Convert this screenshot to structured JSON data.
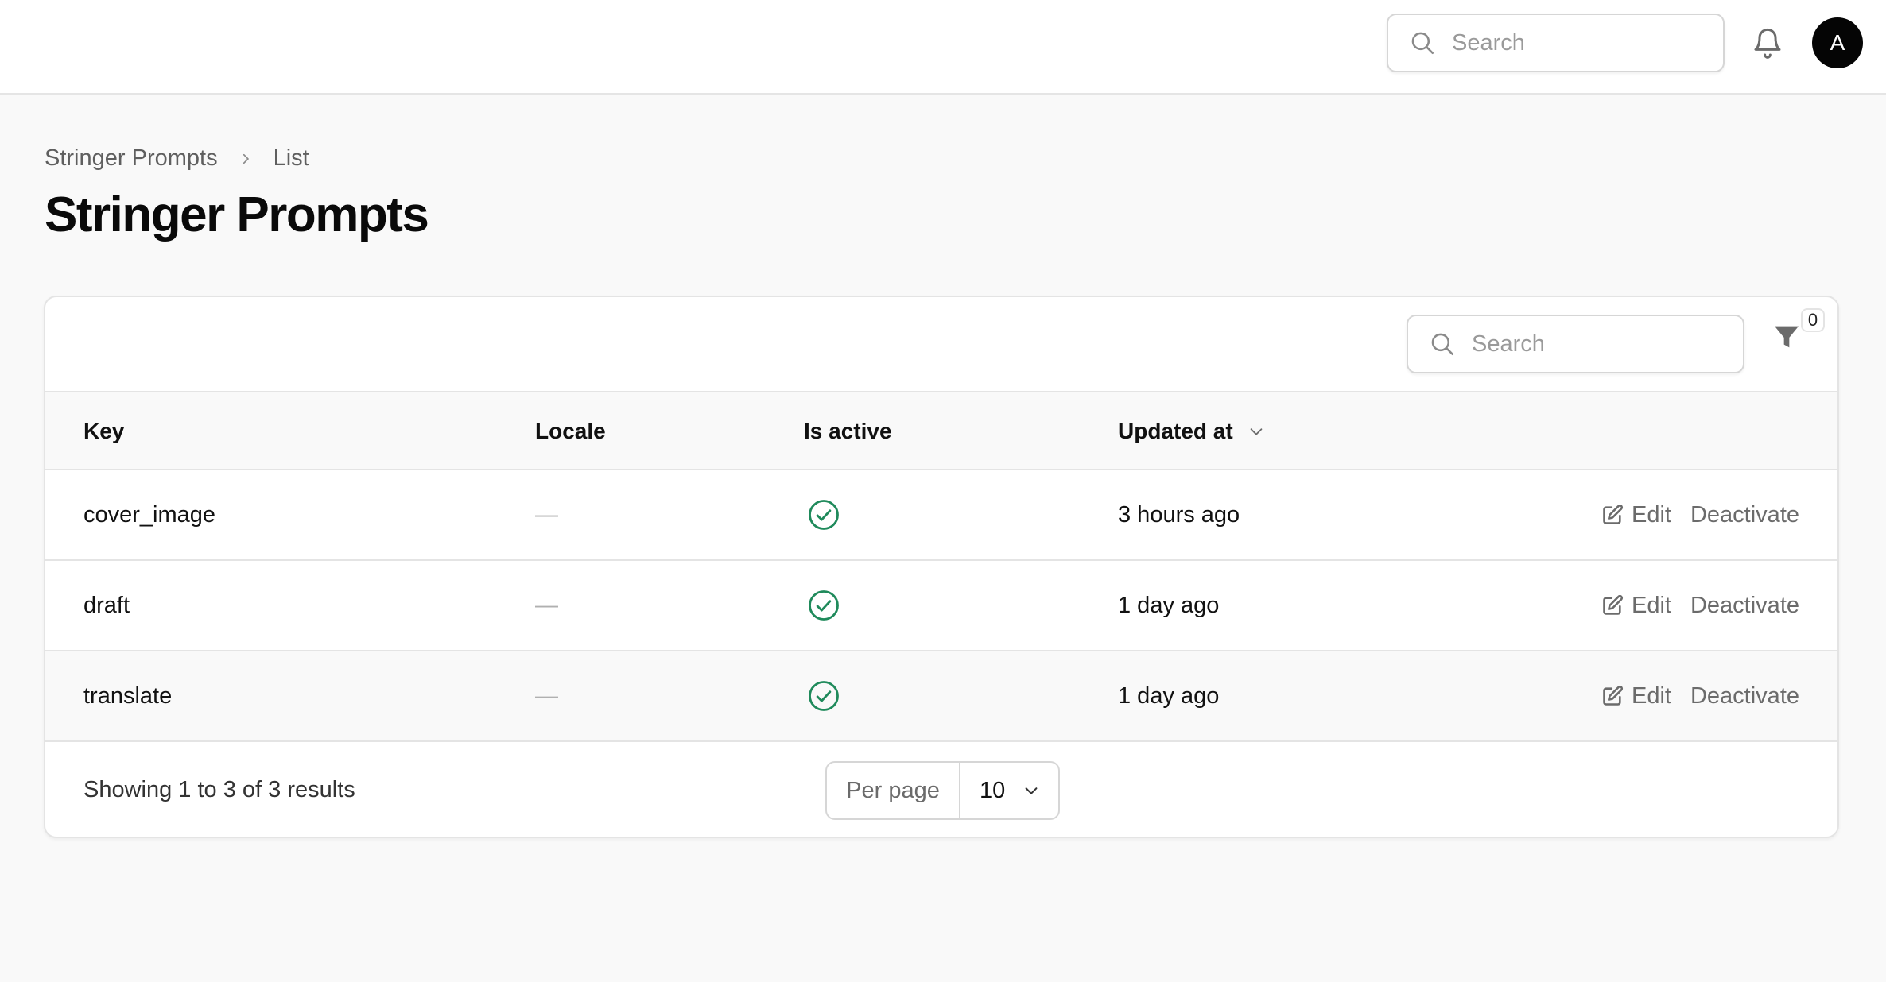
{
  "header": {
    "search_placeholder": "Search",
    "avatar_initial": "A"
  },
  "breadcrumb": {
    "items": [
      "Stringer Prompts",
      "List"
    ]
  },
  "page": {
    "title": "Stringer Prompts"
  },
  "table": {
    "search_placeholder": "Search",
    "filter_count": "0",
    "columns": {
      "key": "Key",
      "locale": "Locale",
      "is_active": "Is active",
      "updated_at": "Updated at"
    },
    "rows": [
      {
        "key": "cover_image",
        "locale": "—",
        "updated_at": "3 hours ago",
        "edit": "Edit",
        "deactivate": "Deactivate"
      },
      {
        "key": "draft",
        "locale": "—",
        "updated_at": "1 day ago",
        "edit": "Edit",
        "deactivate": "Deactivate"
      },
      {
        "key": "translate",
        "locale": "—",
        "updated_at": "1 day ago",
        "edit": "Edit",
        "deactivate": "Deactivate"
      }
    ],
    "footer": {
      "results_text": "Showing 1 to 3 of 3 results",
      "per_page_label": "Per page",
      "per_page_value": "10"
    }
  },
  "colors": {
    "active_check": "#1f8a5b",
    "icon_gray": "#6b6b6b"
  }
}
